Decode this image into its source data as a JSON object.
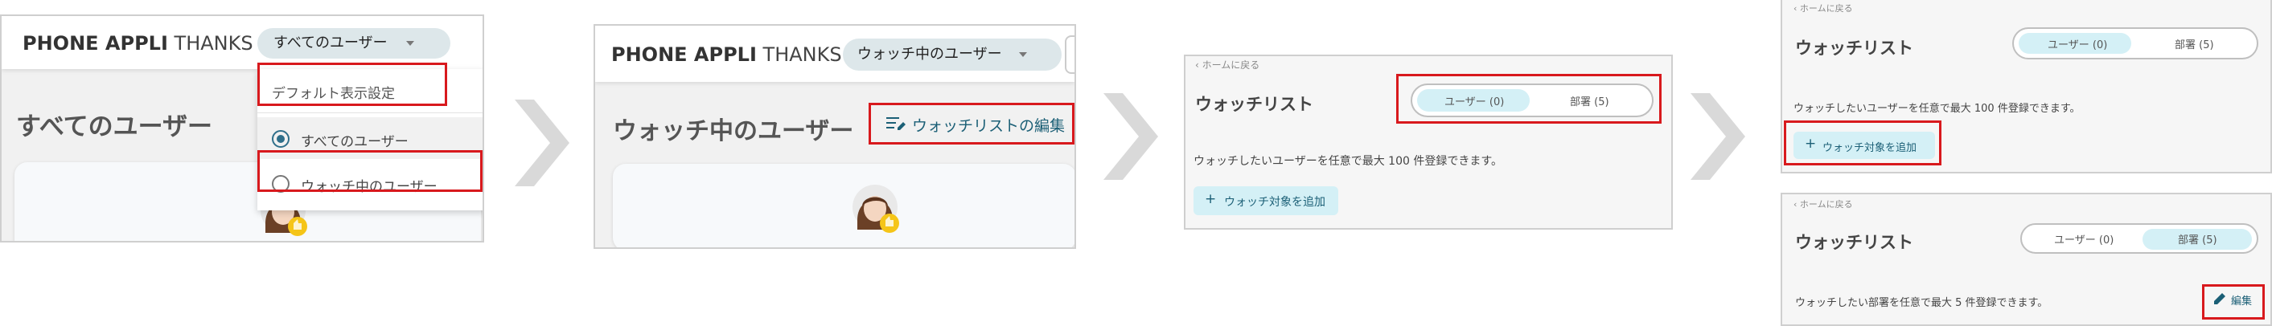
{
  "brand": {
    "bold": "PHONE APPLI",
    "light": "THANKS"
  },
  "step1": {
    "dropdown_label": "すべてのユーザー",
    "heading": "すべてのユーザー",
    "menu": {
      "default_setting": "デフォルト表示設定",
      "option_all": "すべてのユーザー",
      "option_watch": "ウォッチ中のユーザー"
    }
  },
  "step2": {
    "dropdown_label": "ウォッチ中のユーザー",
    "heading": "ウォッチ中のユーザー",
    "edit_watchlist": "ウォッチリストの編集"
  },
  "watchlist": {
    "back": "ホームに戻る",
    "title": "ウォッチリスト",
    "tab_users": "ユーザー (0)",
    "tab_departments": "部署 (5)",
    "users_desc": "ウォッチしたいユーザーを任意で最大 100 件登録できます。",
    "departments_desc": "ウォッチしたい部署を任意で最大 5 件登録できます。",
    "add_button": "ウォッチ対象を追加",
    "edit_button": "編集"
  },
  "colors": {
    "highlight": "#d8191d",
    "accent_bg": "#d4f0f6",
    "accent_text": "#1b5f76"
  }
}
